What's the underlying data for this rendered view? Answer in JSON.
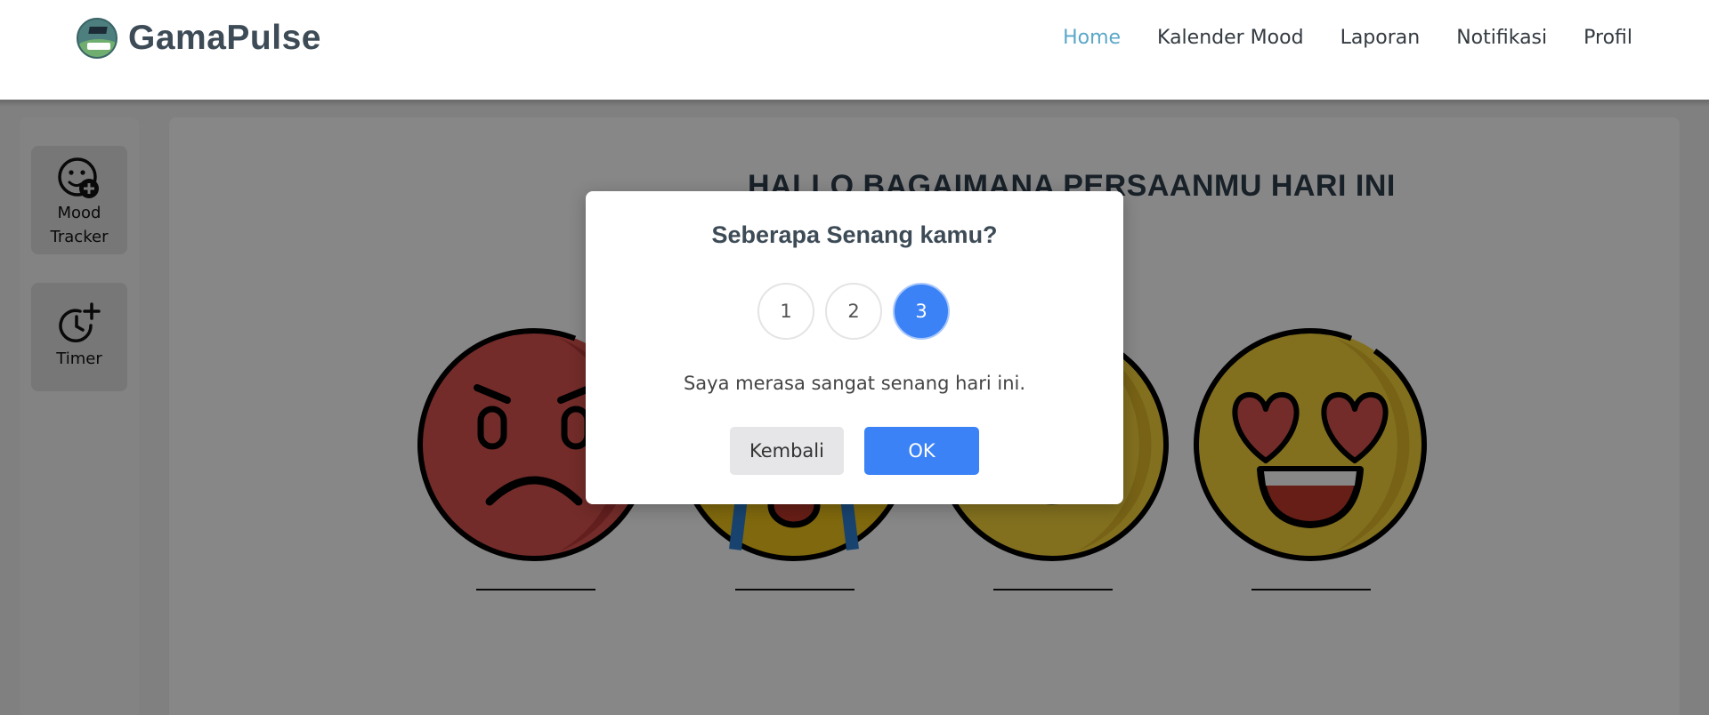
{
  "header": {
    "brand": "GamaPulse",
    "nav": [
      {
        "label": "Home",
        "active": true
      },
      {
        "label": "Kalender Mood",
        "active": false
      },
      {
        "label": "Laporan",
        "active": false
      },
      {
        "label": "Notifikasi",
        "active": false
      },
      {
        "label": "Profil",
        "active": false
      }
    ]
  },
  "sidebar": {
    "items": [
      {
        "label_line1": "Mood",
        "label_line2": "Tracker",
        "icon": "face-plus-icon"
      },
      {
        "label": "Timer",
        "icon": "clock-plus-icon"
      }
    ]
  },
  "main": {
    "greeting": "HALLO BAGAIMANA PERSAANMU HARI INI",
    "moods": [
      {
        "name": "angry",
        "color": "#d9534f"
      },
      {
        "name": "crying",
        "color": "#f0c419"
      },
      {
        "name": "happy",
        "color": "#f6d43c"
      },
      {
        "name": "heart-eyes",
        "color": "#f6d43c"
      }
    ]
  },
  "modal": {
    "title": "Seberapa Senang kamu?",
    "options": [
      "1",
      "2",
      "3"
    ],
    "selected": "3",
    "message": "Saya merasa sangat senang hari ini.",
    "back_label": "Kembali",
    "ok_label": "OK"
  },
  "colors": {
    "accent": "#3b82f6",
    "nav_active": "#5aa7c8",
    "title": "#3d4b56"
  }
}
